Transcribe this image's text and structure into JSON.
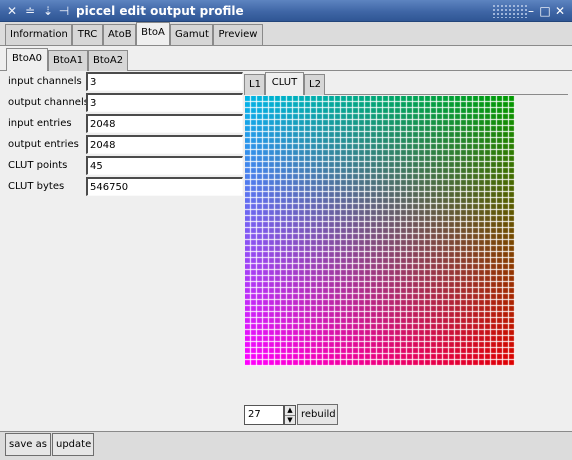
{
  "window": {
    "title": "piccel edit output profile",
    "icons": [
      "close-x-icon",
      "minimize-small-icon",
      "pin-icon",
      "shade-icon"
    ],
    "controls": [
      "minimize-icon",
      "maximize-icon",
      "close-icon"
    ]
  },
  "main_tabs": [
    {
      "label": "Information",
      "active": false
    },
    {
      "label": "TRC",
      "active": false
    },
    {
      "label": "AtoB",
      "active": false
    },
    {
      "label": "BtoA",
      "active": true
    },
    {
      "label": "Gamut",
      "active": false
    },
    {
      "label": "Preview",
      "active": false
    }
  ],
  "sub_tabs": [
    {
      "label": "BtoA0",
      "active": true
    },
    {
      "label": "BtoA1",
      "active": false
    },
    {
      "label": "BtoA2",
      "active": false
    }
  ],
  "fields": [
    {
      "label": "input channels",
      "value": "3"
    },
    {
      "label": "output channels",
      "value": "3"
    },
    {
      "label": "input entries",
      "value": "2048"
    },
    {
      "label": "output entries",
      "value": "2048"
    },
    {
      "label": "CLUT points",
      "value": "45"
    },
    {
      "label": "CLUT bytes",
      "value": "546750"
    }
  ],
  "view_tabs": [
    {
      "label": "L1",
      "active": false
    },
    {
      "label": "CLUT",
      "active": true
    },
    {
      "label": "L2",
      "active": false
    }
  ],
  "clut_view": {
    "grid_cells_per_side": 45,
    "corner_colors": {
      "top_left": "#00b4e6",
      "top_right": "#009900",
      "bottom_left": "#ff00ff",
      "bottom_right": "#dd0000"
    }
  },
  "slice": {
    "value": "27",
    "rebuild_label": "rebuild"
  },
  "footer": {
    "save_as_label": "save as",
    "update_label": "update"
  }
}
